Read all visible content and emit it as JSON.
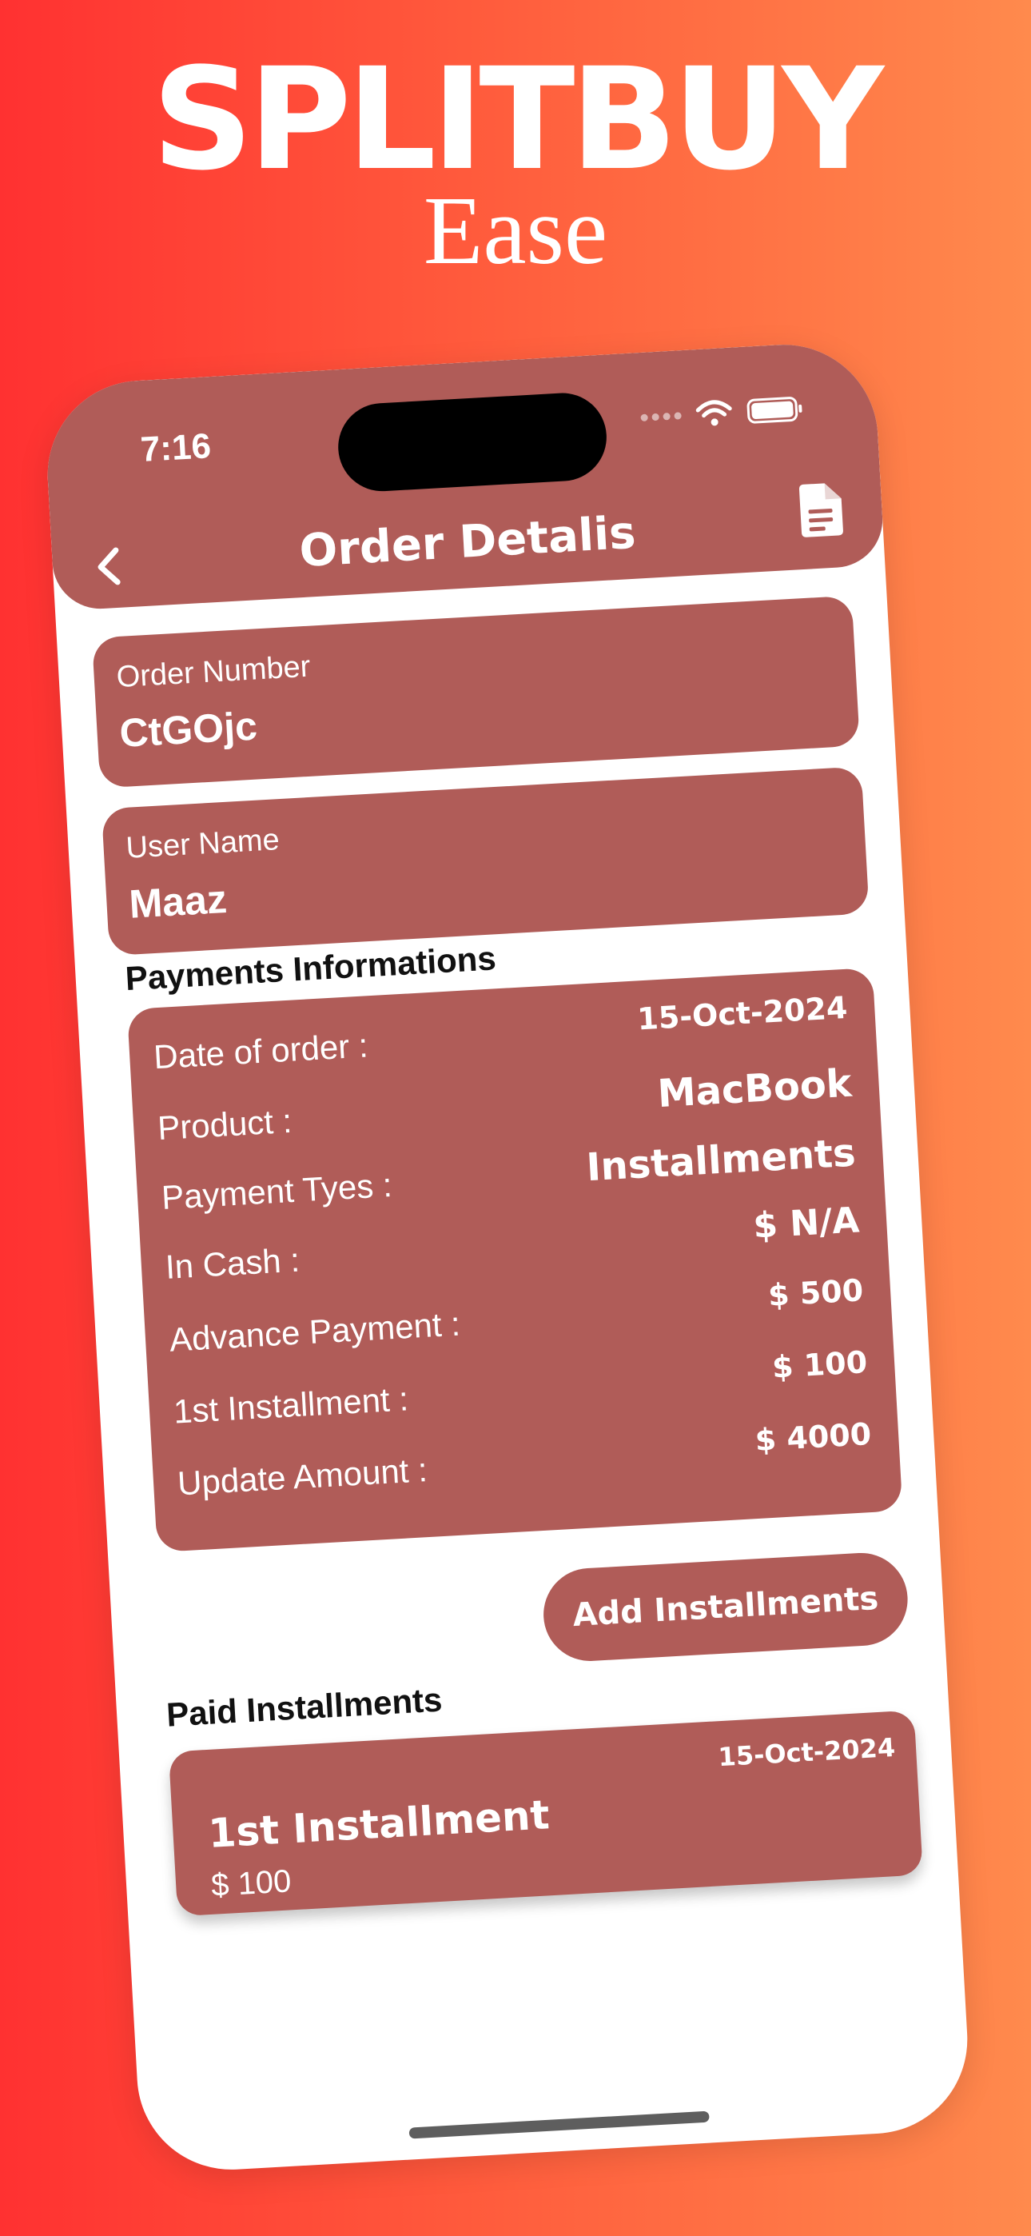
{
  "brand": {
    "title": "SPLITBUY",
    "subtitle": "Ease"
  },
  "status_bar": {
    "time": "7:16"
  },
  "nav": {
    "title": "Order Detalis"
  },
  "order_number": {
    "label": "Order Number",
    "value": "CtGOjc"
  },
  "user_name": {
    "label": "User Name",
    "value": "Maaz"
  },
  "payments": {
    "heading": "Payments Informations",
    "rows": [
      {
        "label": "Date of order :",
        "value": "15-Oct-2024"
      },
      {
        "label": "Product :",
        "value": "MacBook"
      },
      {
        "label": "Payment Tyes :",
        "value": "Installments"
      },
      {
        "label": "In Cash :",
        "value": "$ N/A"
      },
      {
        "label": "Advance Payment :",
        "value": "$ 500"
      },
      {
        "label": "1st Installment :",
        "value": "$ 100"
      },
      {
        "label": "Update Amount :",
        "value": "$ 4000"
      }
    ]
  },
  "add_installments": {
    "label": "Add Installments"
  },
  "paid": {
    "heading": "Paid Installments",
    "items": [
      {
        "title": "1st Installment",
        "amount": "$ 100",
        "date": "15-Oct-2024"
      }
    ]
  },
  "colors": {
    "accent": "#b05c58",
    "gradient_start": "#ff3131",
    "gradient_end": "#ff8a4d"
  }
}
